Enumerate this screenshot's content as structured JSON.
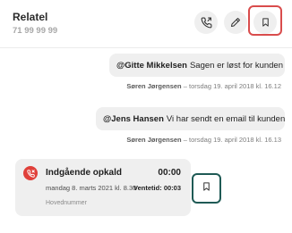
{
  "header": {
    "name": "Relatel",
    "number": "71 99 99 99",
    "actions": {
      "call_icon": "phone-transfer-icon",
      "edit_icon": "pencil-icon",
      "bookmark_icon": "bookmark-icon"
    }
  },
  "messages": [
    {
      "mention": "@Gitte Mikkelsen",
      "text": "Sagen er løst for kunden",
      "author": "Søren Jørgensen",
      "timestamp": "– torsdag 19. april 2018 kl. 16.12"
    },
    {
      "mention": "@Jens Hansen",
      "text": "Vi har sendt en email til kunden",
      "author": "Søren Jørgensen",
      "timestamp": "– torsdag 19. april 2018 kl. 16.13"
    }
  ],
  "call": {
    "title": "Indgående opkald",
    "duration": "00:00",
    "date": "mandag 8. marts 2021 kl. 8.30",
    "wait_label": "Ventetid:",
    "wait_value": "00:03",
    "line": "Hovednummer",
    "icon": "phone-missed-icon",
    "bookmark_icon": "bookmark-icon"
  },
  "colors": {
    "highlight_red": "#d94c4c",
    "highlight_teal": "#1f5a55",
    "call_icon_bg": "#e0403a",
    "bubble_bg": "#efefef"
  }
}
